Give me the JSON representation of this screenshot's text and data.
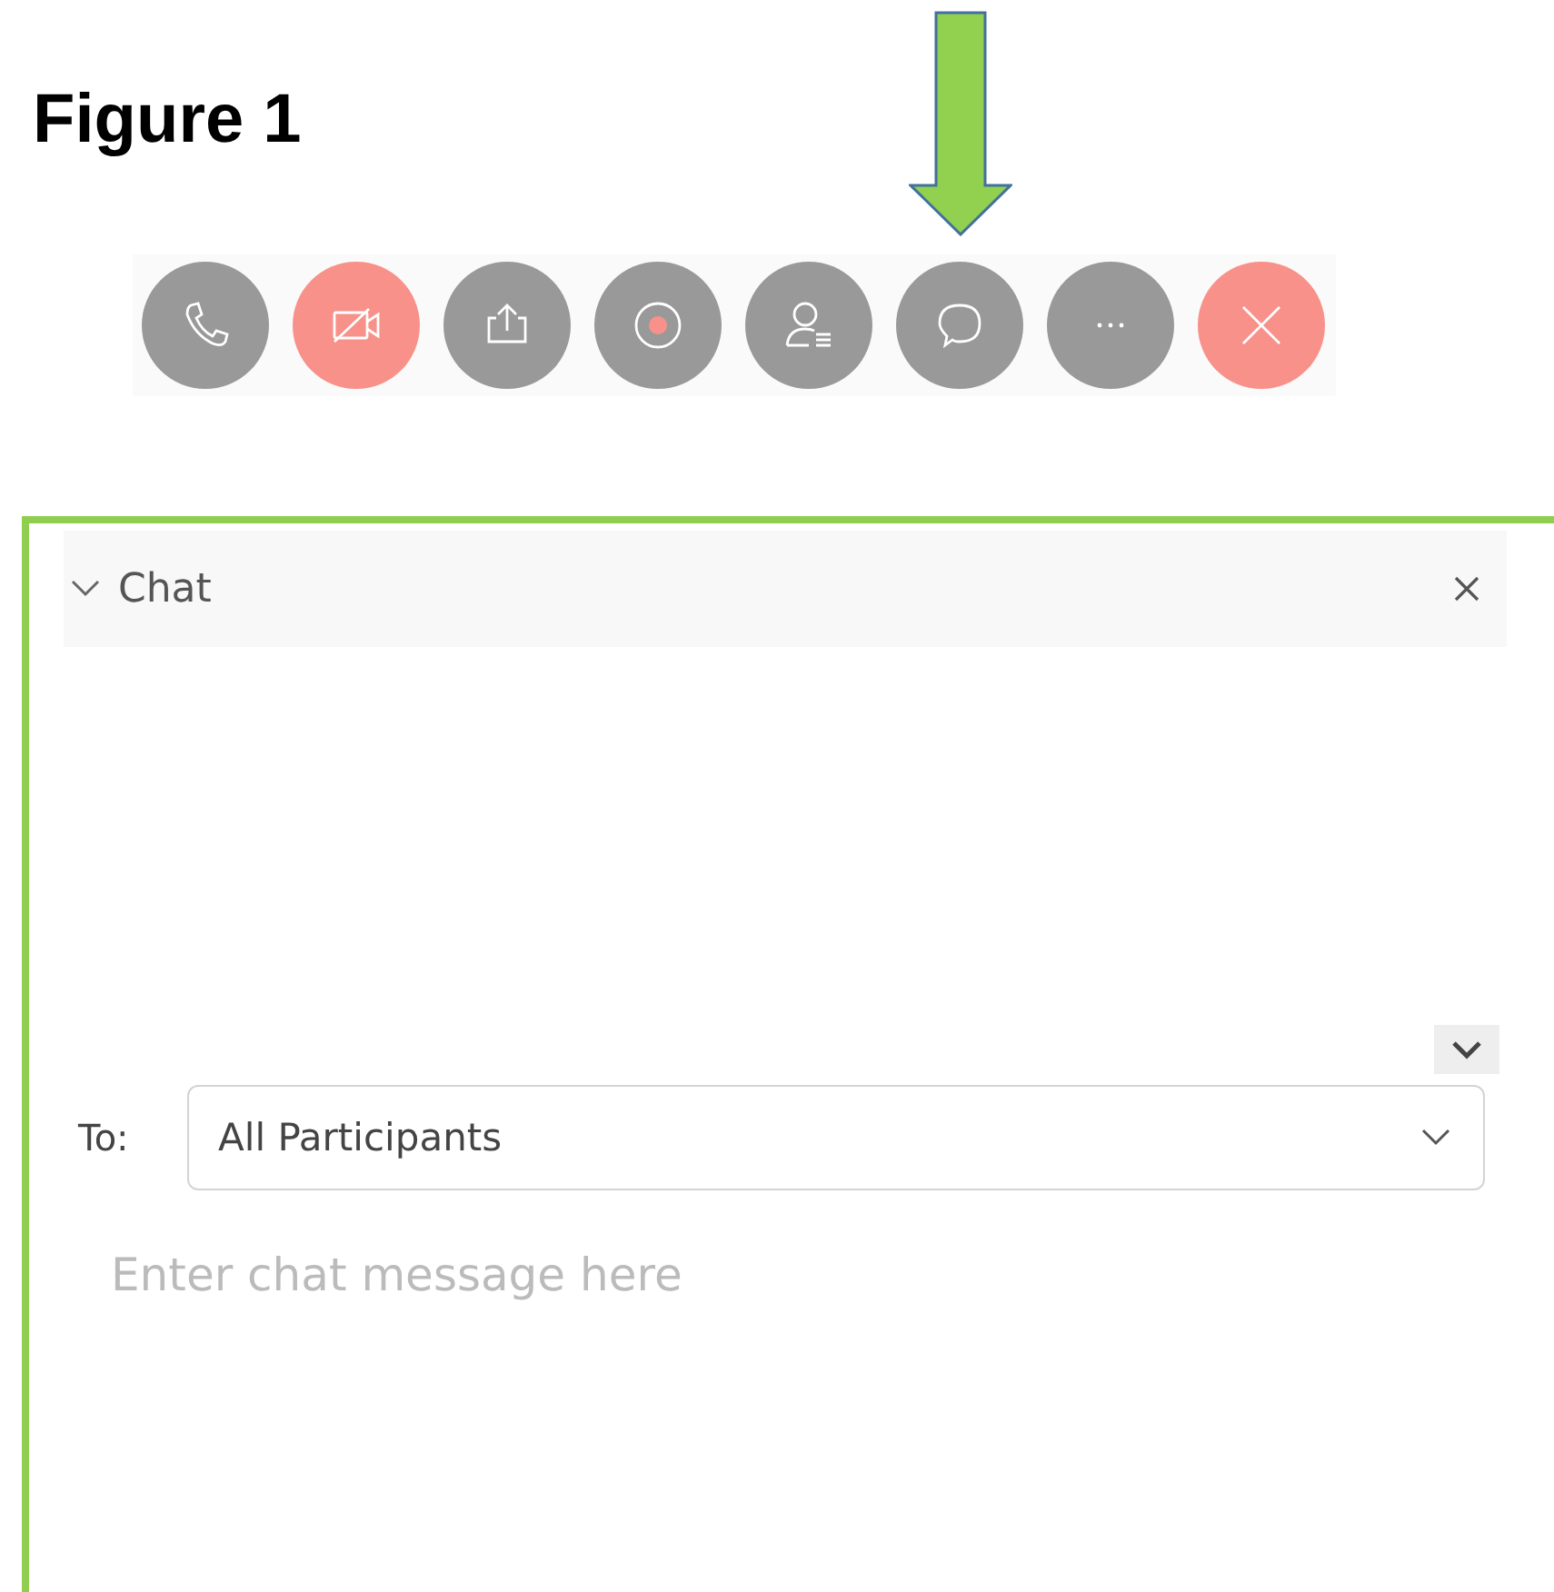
{
  "figure_title": "Figure 1",
  "toolbar": [
    {
      "kind": "phone",
      "color": "#999999",
      "pointed": false
    },
    {
      "kind": "video-off",
      "color": "#f8918a",
      "pointed": false
    },
    {
      "kind": "share",
      "color": "#999999",
      "pointed": false
    },
    {
      "kind": "record",
      "color": "#999999",
      "pointed": false
    },
    {
      "kind": "participants",
      "color": "#999999",
      "pointed": false
    },
    {
      "kind": "chat",
      "color": "#999999",
      "pointed": true
    },
    {
      "kind": "more",
      "color": "#999999",
      "pointed": false
    },
    {
      "kind": "end",
      "color": "#f8918a",
      "pointed": false
    }
  ],
  "chat_panel": {
    "title": "Chat",
    "expanded": true,
    "to_label": "To:",
    "recipient": "All Participants",
    "message_placeholder": "Enter chat message here"
  }
}
